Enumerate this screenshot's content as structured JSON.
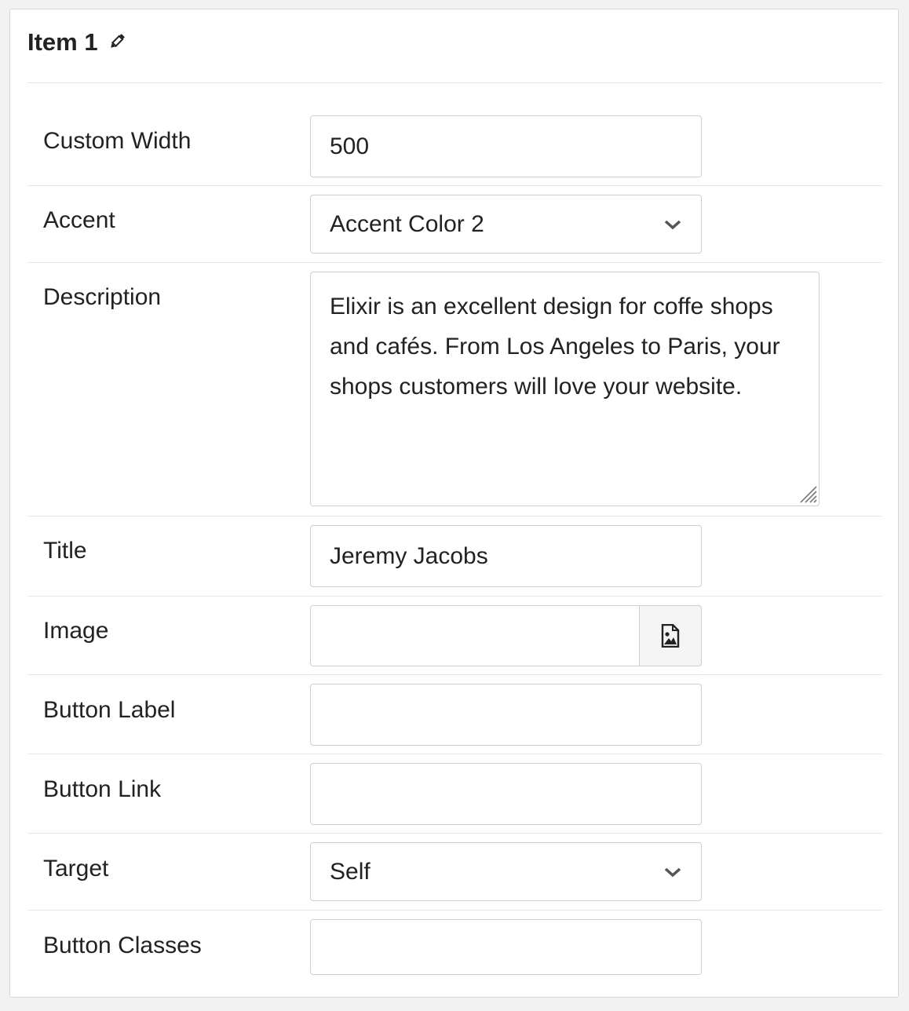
{
  "item": {
    "title": "Item 1",
    "edit_icon": "pencil-icon"
  },
  "fields": {
    "custom_width": {
      "label": "Custom Width",
      "value": "500"
    },
    "accent": {
      "label": "Accent",
      "value": "Accent Color 2",
      "icon": "chevron-down-icon"
    },
    "description": {
      "label": "Description",
      "value": "Elixir is an excellent design for coffe shops and cafés. From Los Angeles to Paris, your shops customers will love your website."
    },
    "title": {
      "label": "Title",
      "value": "Jeremy Jacobs"
    },
    "image": {
      "label": "Image",
      "value": "",
      "icon": "image-file-icon"
    },
    "button_label": {
      "label": "Button Label",
      "value": ""
    },
    "button_link": {
      "label": "Button Link",
      "value": ""
    },
    "target": {
      "label": "Target",
      "value": "Self",
      "icon": "chevron-down-icon"
    },
    "button_classes": {
      "label": "Button Classes",
      "value": ""
    }
  }
}
